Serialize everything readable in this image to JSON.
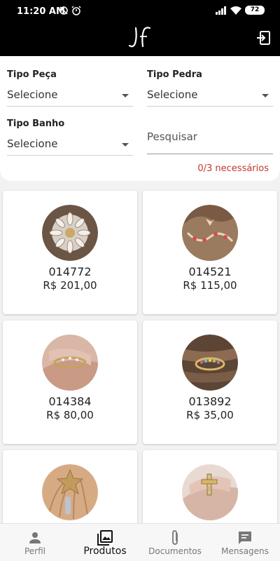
{
  "status_bar": {
    "time": "11:20 AM",
    "battery": "72"
  },
  "app_bar": {
    "logo_text": "JF",
    "logout_icon": "logout-icon"
  },
  "filters": {
    "tipo_peca": {
      "label": "Tipo Peça",
      "value": "Selecione"
    },
    "tipo_pedra": {
      "label": "Tipo Pedra",
      "value": "Selecione"
    },
    "tipo_banho": {
      "label": "Tipo Banho",
      "value": "Selecione"
    },
    "search": {
      "placeholder": "Pesquisar",
      "helper": "0/3 necessários"
    }
  },
  "products": [
    {
      "code": "014772",
      "price": "R$ 201,00",
      "image": "brooch-jewel-photo"
    },
    {
      "code": "014521",
      "price": "R$ 115,00",
      "image": "necklace-photo"
    },
    {
      "code": "014384",
      "price": "R$ 80,00",
      "image": "ring-on-hand-photo"
    },
    {
      "code": "013892",
      "price": "R$ 35,00",
      "image": "ring-on-wood-photo"
    },
    {
      "code": "",
      "price": "",
      "image": "starfish-earring-photo"
    },
    {
      "code": "",
      "price": "",
      "image": "cross-ring-photo"
    }
  ],
  "bottom_nav": [
    {
      "label": "Perfil",
      "icon": "person-icon",
      "active": false
    },
    {
      "label": "Produtos",
      "icon": "gallery-icon",
      "active": true
    },
    {
      "label": "Documentos",
      "icon": "paperclip-icon",
      "active": false
    },
    {
      "label": "Mensagens",
      "icon": "message-icon",
      "active": false
    }
  ],
  "colors": {
    "app_bar": "#000000",
    "helper_error": "#c0392b",
    "background": "#f2f2f2"
  }
}
